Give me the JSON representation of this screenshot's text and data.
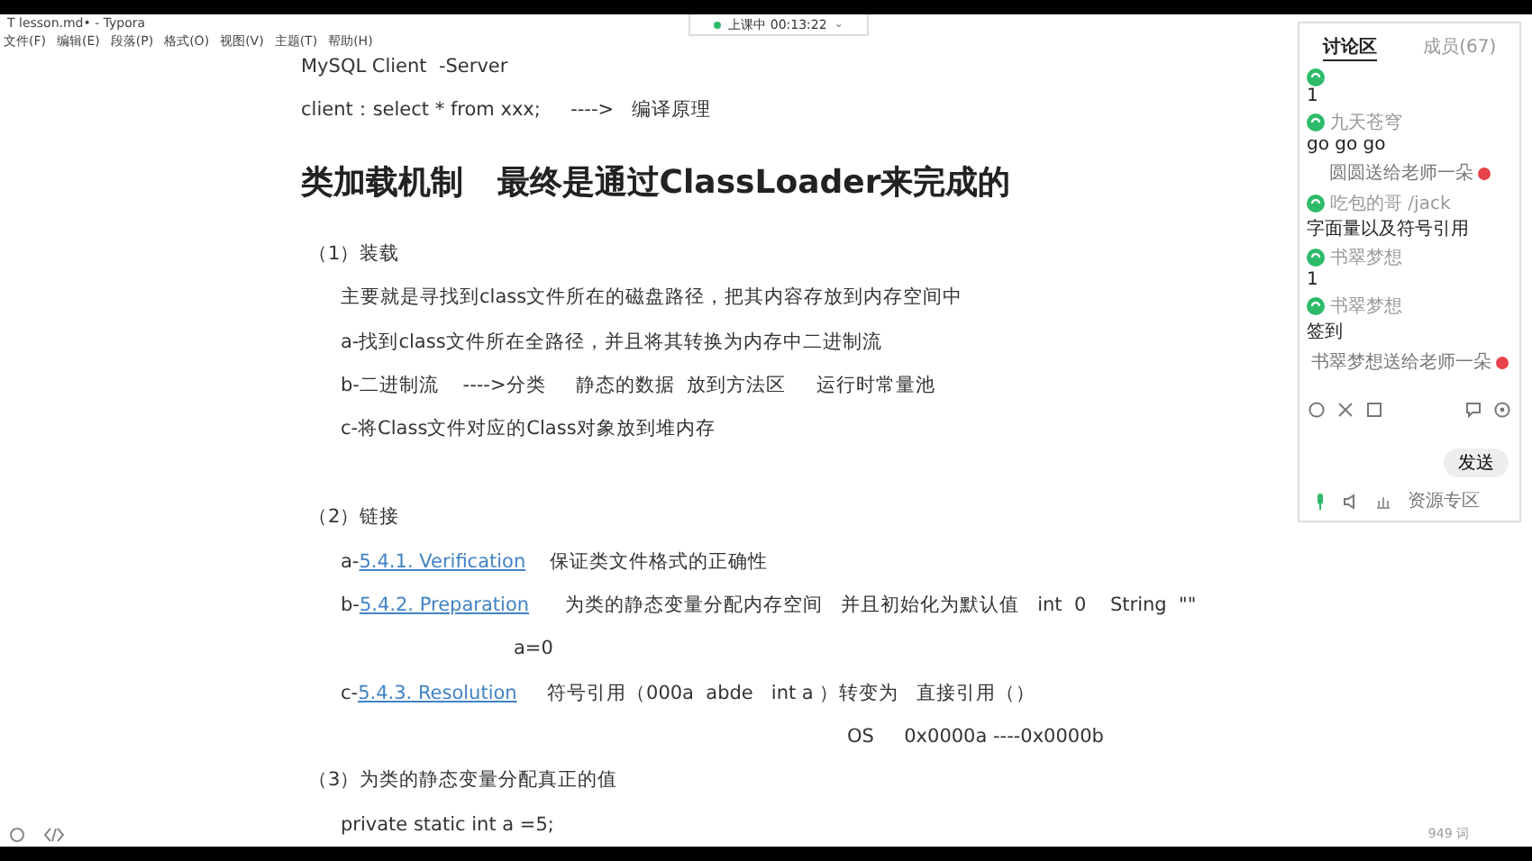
{
  "window": {
    "title": "T  lesson.md• - Typora"
  },
  "menu": [
    "文件(F)",
    "编辑(E)",
    "段落(P)",
    "格式(O)",
    "视图(V)",
    "主题(T)",
    "帮助(H)"
  ],
  "recording": {
    "label": "上课中 00:13:22",
    "caret": "⌄"
  },
  "document": [
    {
      "kind": "plain",
      "text": "MySQL Client  -Server"
    },
    {
      "kind": "plain",
      "text": "client：select * from xxx;     ---->   编译原理"
    },
    {
      "kind": "heading",
      "text": "类加载机制   最终是通过ClassLoader来完成的"
    },
    {
      "kind": "section",
      "text": "（1）装载"
    },
    {
      "kind": "item",
      "text": "主要就是寻找到class文件所在的磁盘路径，把其内容存放到内存空间中"
    },
    {
      "kind": "item",
      "text": "a-找到class文件所在全路径，并且将其转换为内存中二进制流"
    },
    {
      "kind": "item",
      "text": "b-二进制流    ---->分类     静态的数据  放到方法区     运行时常量池"
    },
    {
      "kind": "item",
      "text": "c-将Class文件对应的Class对象放到堆内存"
    },
    {
      "kind": "blank"
    },
    {
      "kind": "section",
      "text": "（2）链接"
    },
    {
      "kind": "link",
      "prefix": "a-",
      "link": "5.4.1. Verification",
      "text": "    保证类文件格式的正确性"
    },
    {
      "kind": "link",
      "prefix": "b-",
      "link": "5.4.2. Preparation",
      "text": "      为类的静态变量分配内存空间   并且初始化为默认值   int  0    String  \"\""
    },
    {
      "kind": "cont",
      "text": "a=0"
    },
    {
      "kind": "link",
      "prefix": "c-",
      "link": "5.4.3. Resolution",
      "text": "     符号引用（000a  abde   int a ）转变为   直接引用（）"
    },
    {
      "kind": "far",
      "text": "OS     0x0000a ----0x0000b"
    },
    {
      "kind": "section",
      "text": "（3）为类的静态变量分配真正的值"
    },
    {
      "kind": "item",
      "text": "private static int a =5;"
    }
  ],
  "status_bar": {
    "word_count": "949 词"
  },
  "chat": {
    "tabs": [
      {
        "label": "讨论区",
        "selected": true
      },
      {
        "label": "成员(67)",
        "selected": false
      }
    ],
    "messages": [
      {
        "kind": "message",
        "text": "1"
      },
      {
        "kind": "message",
        "name": "九天苍穹",
        "text": "go go go"
      },
      {
        "kind": "gift",
        "text": "圆圆送给老师一朵"
      },
      {
        "kind": "message",
        "name": "吃包的哥 /jack",
        "text": "字面量以及符号引用"
      },
      {
        "kind": "message",
        "name": "书翠梦想",
        "text": "1"
      },
      {
        "kind": "message",
        "name": "书翠梦想",
        "text": "签到"
      },
      {
        "kind": "gift",
        "text": "书翠梦想送给老师一朵"
      }
    ],
    "send": "发送",
    "footer": "资源专区"
  }
}
